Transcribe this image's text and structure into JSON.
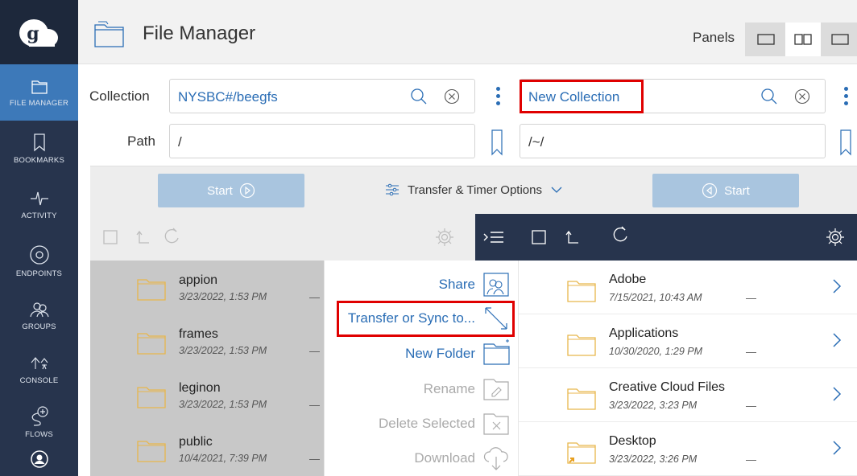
{
  "app": {
    "title": "File Manager",
    "panels_label": "Panels"
  },
  "sidebar": {
    "items": [
      {
        "label": "FILE MANAGER",
        "icon": "folder-icon",
        "active": true
      },
      {
        "label": "BOOKMARKS",
        "icon": "bookmark-icon"
      },
      {
        "label": "ACTIVITY",
        "icon": "activity-icon"
      },
      {
        "label": "ENDPOINTS",
        "icon": "endpoints-icon"
      },
      {
        "label": "GROUPS",
        "icon": "groups-icon"
      },
      {
        "label": "CONSOLE",
        "icon": "console-icon"
      },
      {
        "label": "FLOWS",
        "icon": "flows-icon"
      },
      {
        "label": "",
        "icon": "account-icon"
      }
    ]
  },
  "left": {
    "collection_label": "Collection",
    "collection_value": "NYSBC#/beegfs",
    "path_label": "Path",
    "path_value": "/",
    "start_label": "Start"
  },
  "right": {
    "collection_value": "New Collection",
    "path_value": "/~/",
    "start_label": "Start"
  },
  "transfer_options_label": "Transfer & Timer Options",
  "left_files": [
    {
      "name": "appion",
      "date": "3/23/2022, 1:53 PM",
      "size": "—"
    },
    {
      "name": "frames",
      "date": "3/23/2022, 1:53 PM",
      "size": "—"
    },
    {
      "name": "leginon",
      "date": "3/23/2022, 1:53 PM",
      "size": "—"
    },
    {
      "name": "public",
      "date": "10/4/2021, 7:39 PM",
      "size": "—"
    }
  ],
  "menu": {
    "items": [
      {
        "label": "Share",
        "icon": "share-icon",
        "enabled": true
      },
      {
        "label": "Transfer or Sync to...",
        "icon": "transfer-icon",
        "enabled": true
      },
      {
        "label": "New Folder",
        "icon": "new-folder-icon",
        "enabled": true
      },
      {
        "label": "Rename",
        "icon": "rename-icon",
        "enabled": false
      },
      {
        "label": "Delete Selected",
        "icon": "delete-icon",
        "enabled": false
      },
      {
        "label": "Download",
        "icon": "download-icon",
        "enabled": false
      }
    ]
  },
  "right_files": [
    {
      "name": "Adobe",
      "date": "7/15/2021, 10:43 AM",
      "size": "—"
    },
    {
      "name": "Applications",
      "date": "10/30/2020, 1:29 PM",
      "size": "—"
    },
    {
      "name": "Creative Cloud Files",
      "date": "3/23/2022, 3:23 PM",
      "size": "—"
    },
    {
      "name": "Desktop",
      "date": "3/23/2022, 3:26 PM",
      "size": "—"
    }
  ],
  "colors": {
    "sidebar": "#27344d",
    "active": "#3d79b9",
    "accent": "#2a6db5",
    "highlight": "#e00000",
    "folder": "#e8b64c"
  }
}
